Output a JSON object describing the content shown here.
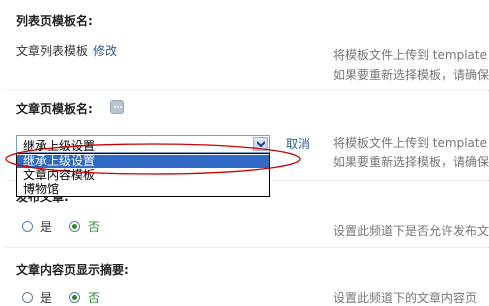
{
  "list_template": {
    "label": "列表页模板名:",
    "value": "文章列表模板",
    "edit_link": "修改",
    "hint_line1": "将模板文件上传到 template",
    "hint_line2": "如果要重新选择模板，请确保"
  },
  "article_template": {
    "label": "文章页模板名:",
    "select_value": "继承上级设置",
    "cancel_link": "取消",
    "hint_line1": "将模板文件上传到 template",
    "hint_line2": "如果要重新选择模板，请确保",
    "options": [
      "继承上级设置",
      "文章内容模板",
      "博物馆"
    ]
  },
  "publish": {
    "label_partial": "发布文章:",
    "yes": "是",
    "no": "否",
    "selected": "否",
    "hint": "设置此频道下是否允许发布文"
  },
  "summary": {
    "label": "文章内容页显示摘要:",
    "yes": "是",
    "no": "否",
    "selected": "否",
    "hint": "设置此频道下的文章内容页"
  },
  "colors": {
    "accent_link": "#2a5d8f",
    "selection": "#316ac5",
    "annotation": "#cc0000",
    "radio_green": "#2b8a2b"
  }
}
